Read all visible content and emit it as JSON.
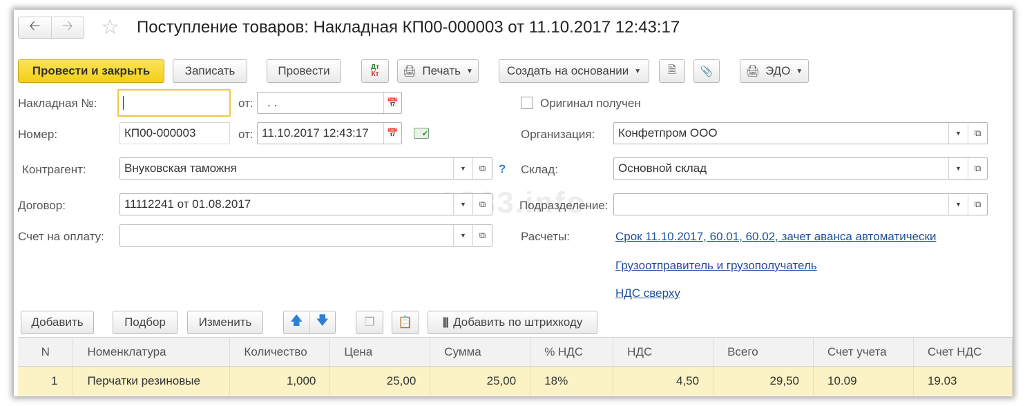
{
  "window": {
    "title": "Поступление товаров: Накладная КП00-000003 от 11.10.2017 12:43:17",
    "back_icon": "arrow-left",
    "forward_icon": "arrow-right",
    "favorite_icon": "star"
  },
  "toolbar": {
    "post_close": "Провести и закрыть",
    "save": "Записать",
    "post": "Провести",
    "dtkt": "Дт Кт",
    "print": "Печать",
    "create_based": "Создать на основании",
    "edo": "ЭДО"
  },
  "form": {
    "invoice_label": "Накладная №:",
    "invoice_value": "",
    "invoice_date_label": "от:",
    "invoice_date_value": ". .",
    "number_label": "Номер:",
    "number_value": "КП00-000003",
    "number_date_label": "от:",
    "number_date_value": "11.10.2017 12:43:17",
    "original_label": "Оригинал получен",
    "original_checked": false,
    "org_label": "Организация:",
    "org_value": "Конфетпром ООО",
    "contractor_label": "Контрагент:",
    "contractor_value": "Внуковская таможня",
    "help_mark": "?",
    "warehouse_label": "Склад:",
    "warehouse_value": "Основной склад",
    "contract_label": "Договор:",
    "contract_value": "11112241 от 01.08.2017",
    "division_label": "Подразделение:",
    "division_value": "",
    "payment_label": "Счет на оплату:",
    "payment_value": "",
    "settlements_label": "Расчеты:",
    "settlements_link": "Срок 11.10.2017, 60.01, 60.02, зачет аванса автоматически",
    "shipper_link": "Грузоотправитель и грузополучатель",
    "vat_link": "НДС сверху"
  },
  "watermark": "1S83.info",
  "table_toolbar": {
    "add": "Добавить",
    "pick": "Подбор",
    "edit": "Изменить",
    "barcode": "Добавить по штрихкоду"
  },
  "table": {
    "headers": [
      "N",
      "Номенклатура",
      "Количество",
      "Цена",
      "Сумма",
      "% НДС",
      "НДС",
      "Всего",
      "Счет учета",
      "Счет НДС"
    ],
    "rows": [
      [
        "1",
        "Перчатки резиновые",
        "1,000",
        "25,00",
        "25,00",
        "18%",
        "4,50",
        "29,50",
        "10.09",
        "19.03"
      ]
    ]
  },
  "colors": {
    "primary_button": "#f3cf17",
    "link": "#1f4e9c",
    "selected_row": "#fbf2c5"
  }
}
